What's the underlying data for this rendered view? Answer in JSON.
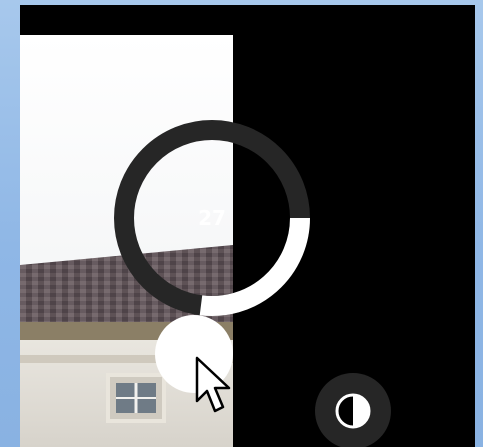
{
  "dial": {
    "value": "27",
    "level": 0.27
  },
  "icons": {
    "contrast": "contrast-icon",
    "cursor": "mouse-pointer-icon"
  },
  "colors": {
    "track": "#262626",
    "fill": "#ffffff",
    "background": "#000000"
  }
}
